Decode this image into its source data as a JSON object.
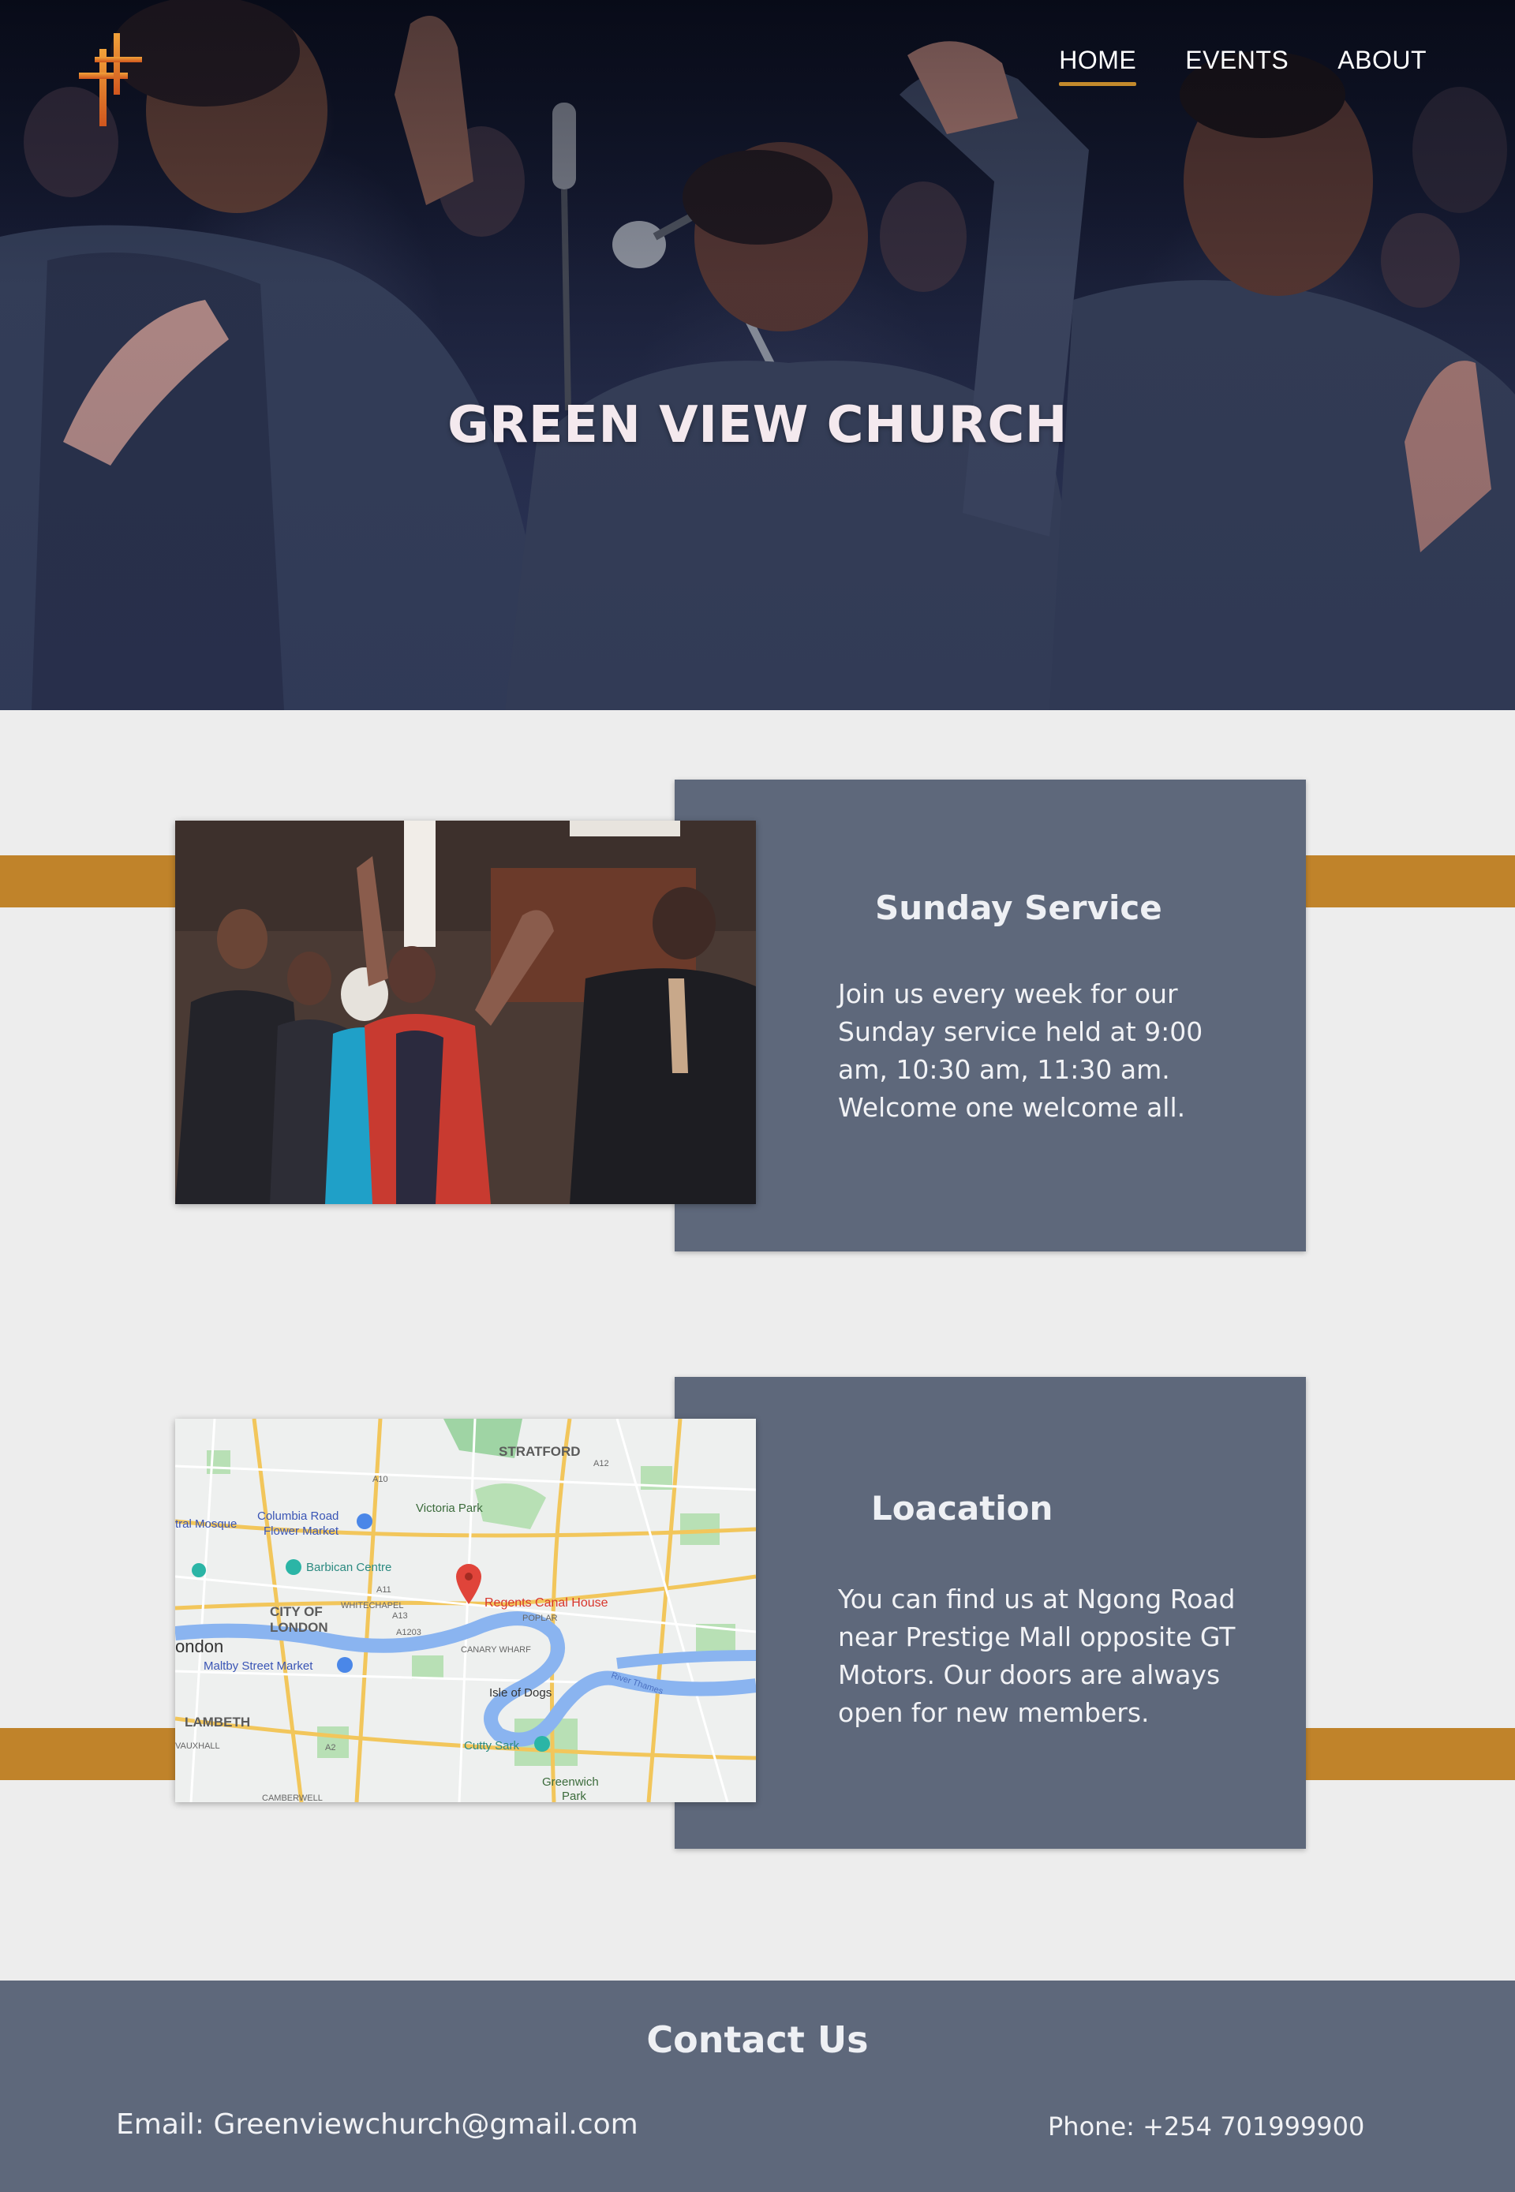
{
  "header": {
    "logo_icon": "cross-icon",
    "nav": [
      {
        "label": "HOME",
        "active": true
      },
      {
        "label": "EVENTS",
        "active": false
      },
      {
        "label": "ABOUT",
        "active": false
      }
    ],
    "hero_title": "GREEN VIEW CHURCH",
    "hero_image": "choir-singing-photo"
  },
  "sections": [
    {
      "image": "worship-congregation-photo",
      "title": "Sunday Service",
      "text": "Join us every week for our Sunday service held at 9:00 am, 10:30 am, 11:30 am. Welcome one welcome all."
    },
    {
      "image": "location-map",
      "title": "Loacation",
      "text": "You can find us at Ngong Road near Prestige Mall opposite GT Motors. Our doors are always open for new members.",
      "map_labels": {
        "stratford": "STRATFORD",
        "victoria_park": "Victoria Park",
        "columbia_road": "Columbia Road",
        "flower_market": "Flower Market",
        "tral_mosque": "tral Mosque",
        "barbican": "Barbican Centre",
        "city_of": "CITY OF",
        "london_city": "LONDON",
        "whitechapel": "WHITECHAPEL",
        "a13": "A13",
        "a1203": "A1203",
        "poplar": "POPLAR",
        "regents": "Regents Canal House",
        "ondon": "ondon",
        "maltby": "Maltby Street Market",
        "canary": "CANARY WHARF",
        "isle_of_dogs": "Isle of Dogs",
        "river_thames": "River Thames",
        "lambeth": "LAMBETH",
        "cutty_sark": "Cutty Sark",
        "greenwich": "Greenwich",
        "park": "Park",
        "vauxhall": "VAUXHALL",
        "camberwell": "CAMBERWELL",
        "a11": "A11",
        "a2": "A2",
        "a10": "A10",
        "a12": "A12"
      }
    }
  ],
  "footer": {
    "title": "Contact Us",
    "email": "Email: Greenviewchurch@gmail.com",
    "phone": "Phone: +254 701999900"
  },
  "colors": {
    "accent": "#c0832a",
    "card": "#5e687b",
    "background": "#ededed"
  }
}
